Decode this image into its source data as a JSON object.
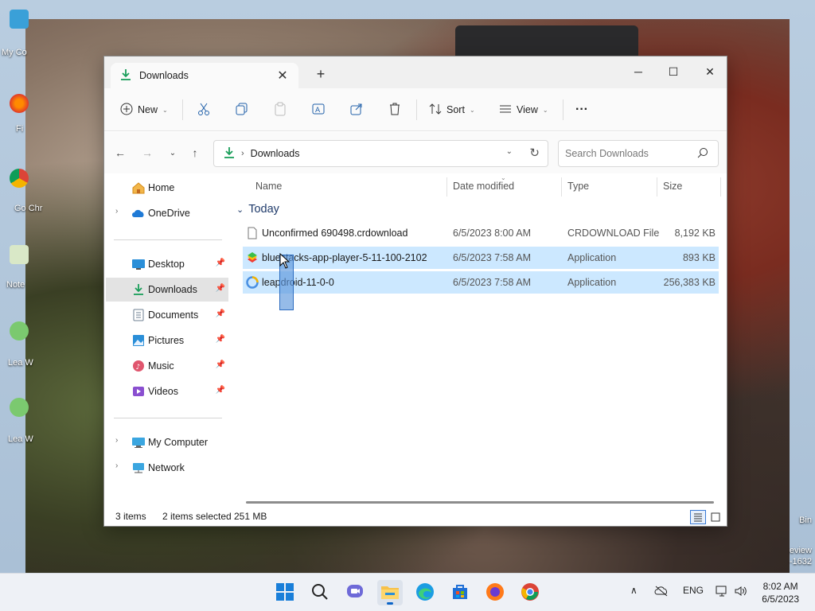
{
  "desktop": {
    "icons": [
      "My Co",
      "Fi",
      "Go Chr",
      "Note",
      "Lea W",
      "Lea W"
    ],
    "right_labels": [
      "Bin",
      "eview",
      "-1632"
    ]
  },
  "window": {
    "tab_title": "Downloads",
    "new_tab": "+",
    "controls": {
      "minimize": "─",
      "maximize": "☐",
      "close": "✕"
    }
  },
  "toolbar": {
    "new_label": "New",
    "sort_label": "Sort",
    "view_label": "View",
    "more_label": "···"
  },
  "address": {
    "path": "Downloads",
    "search_placeholder": "Search Downloads"
  },
  "sidebar": {
    "items": [
      {
        "label": "Home"
      },
      {
        "label": "OneDrive"
      },
      {
        "label": "Desktop"
      },
      {
        "label": "Downloads"
      },
      {
        "label": "Documents"
      },
      {
        "label": "Pictures"
      },
      {
        "label": "Music"
      },
      {
        "label": "Videos"
      },
      {
        "label": "My Computer"
      },
      {
        "label": "Network"
      }
    ]
  },
  "columns": {
    "name": "Name",
    "date": "Date modified",
    "type": "Type",
    "size": "Size"
  },
  "group": {
    "label": "Today"
  },
  "files": [
    {
      "name": "Unconfirmed 690498.crdownload",
      "date": "6/5/2023 8:00 AM",
      "type": "CRDOWNLOAD File",
      "size": "8,192 KB"
    },
    {
      "name": "bluestacks-app-player-5-11-100-2102",
      "date": "6/5/2023 7:58 AM",
      "type": "Application",
      "size": "893 KB"
    },
    {
      "name": "leapdroid-11-0-0",
      "date": "6/5/2023 7:58 AM",
      "type": "Application",
      "size": "256,383 KB"
    }
  ],
  "status": {
    "items_count": "3 items",
    "selected_count": "2 items selected",
    "selected_size": "251 MB"
  },
  "taskbar": {
    "tray_lang": "ENG",
    "time": "8:02 AM",
    "date": "6/5/2023"
  },
  "colors": {
    "accent": "#0a64c8",
    "selection": "#cce8ff",
    "download_green": "#1a9e5a"
  }
}
